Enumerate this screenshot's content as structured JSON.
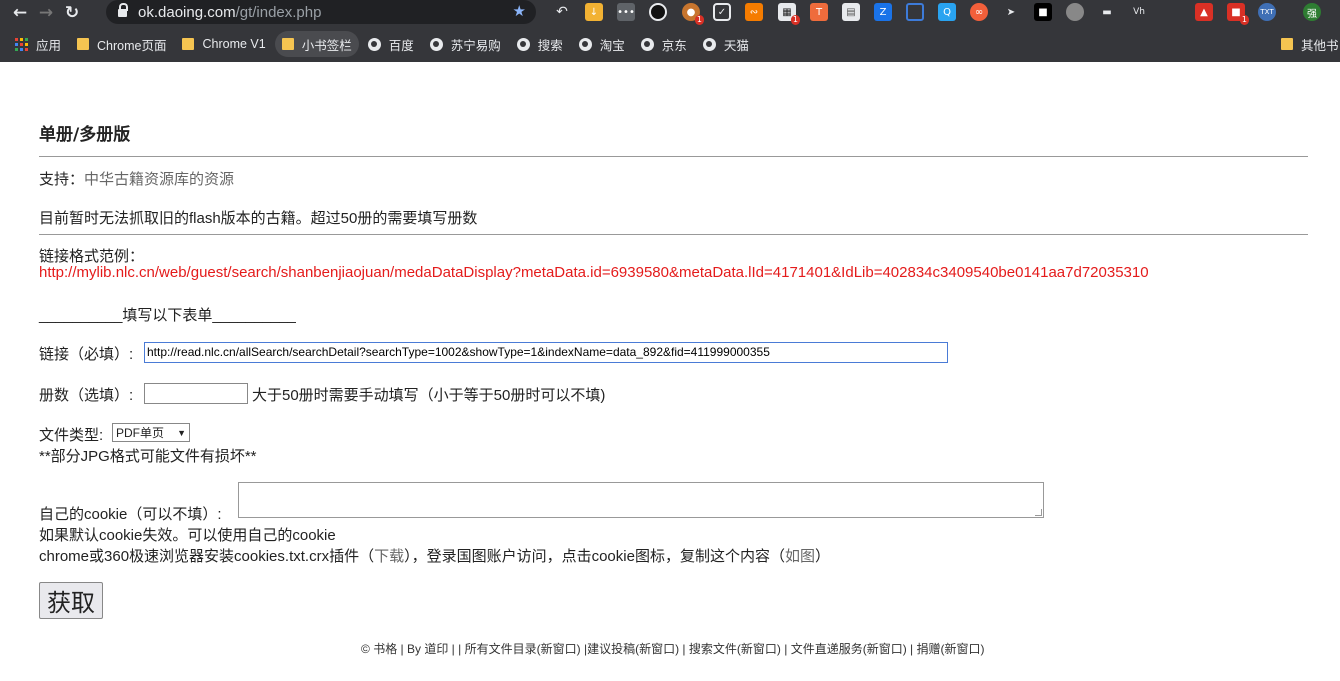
{
  "browser": {
    "url_host": "ok.daoing.com",
    "url_path": "/gt/index.php",
    "bookmarks": [
      {
        "label": "应用",
        "type": "apps"
      },
      {
        "label": "Chrome页面",
        "type": "folder"
      },
      {
        "label": "Chrome V1",
        "type": "folder"
      },
      {
        "label": "小书签栏",
        "type": "folder"
      },
      {
        "label": "百度",
        "type": "globe"
      },
      {
        "label": "苏宁易购",
        "type": "globe"
      },
      {
        "label": "搜索",
        "type": "globe"
      },
      {
        "label": "淘宝",
        "type": "globe"
      },
      {
        "label": "京东",
        "type": "globe"
      },
      {
        "label": "天猫",
        "type": "globe"
      }
    ],
    "other_bookmarks": "其他书",
    "ext_badge_1": "1",
    "ext_badge_2": "1",
    "ext_badge_3": "1"
  },
  "page": {
    "title": "单册/多册版",
    "support_label": "支持：",
    "support_link": "中华古籍资源库的资源",
    "notice": "目前暂时无法抓取旧的flash版本的古籍。超过50册的需要填写册数",
    "example_label": "链接格式范例：",
    "example_url": "http://mylib.nlc.cn/web/guest/search/shanbenjiaojuan/medaDataDisplay?metaData.id=6939580&metaData.lId=4171401&IdLib=402834c3409540be0141aa7d72035310",
    "form_heading": "__________填写以下表单__________",
    "link_label": "链接（必填）:",
    "link_value": "http://read.nlc.cn/allSearch/searchDetail?searchType=1002&showType=1&indexName=data_892&fid=411999000355",
    "volume_label": "册数（选填）:",
    "volume_value": "",
    "volume_hint": "大于50册时需要手动填写（小于等于50册时可以不填)",
    "filetype_label": "文件类型:",
    "filetype_value": "PDF单页",
    "jpg_warning": "**部分JPG格式可能文件有损坏**",
    "cookie_label": "自己的cookie（可以不填）:",
    "cookie_value": "",
    "cookie_hint1": "如果默认cookie失效。可以使用自己的cookie",
    "cookie_hint2_a": "chrome或360极速浏览器安装cookies.txt.crx插件（",
    "cookie_download": "下载",
    "cookie_hint2_b": "），登录国图账户访问，点击cookie图标，复制这个内容（",
    "cookie_image": "如图",
    "cookie_hint2_c": "）",
    "submit": "获取"
  },
  "footer": {
    "copy": "© ",
    "site": "书格",
    "by": " | By ",
    "author": "道印",
    "sep1": " | | ",
    "all_files": "所有文件目录",
    "new_window_1": "(新窗口)",
    "sep2": " |",
    "suggest": "建议投稿",
    "new_window_2": "(新窗口)",
    "sep3": " | ",
    "search_files": "搜索文件",
    "new_window_3": "(新窗口)",
    "sep4": " | ",
    "direct": "文件直递服务",
    "new_window_4": "(新窗口)",
    "sep5": " | ",
    "donate": "捐赠",
    "new_window_5": "(新窗口)"
  }
}
